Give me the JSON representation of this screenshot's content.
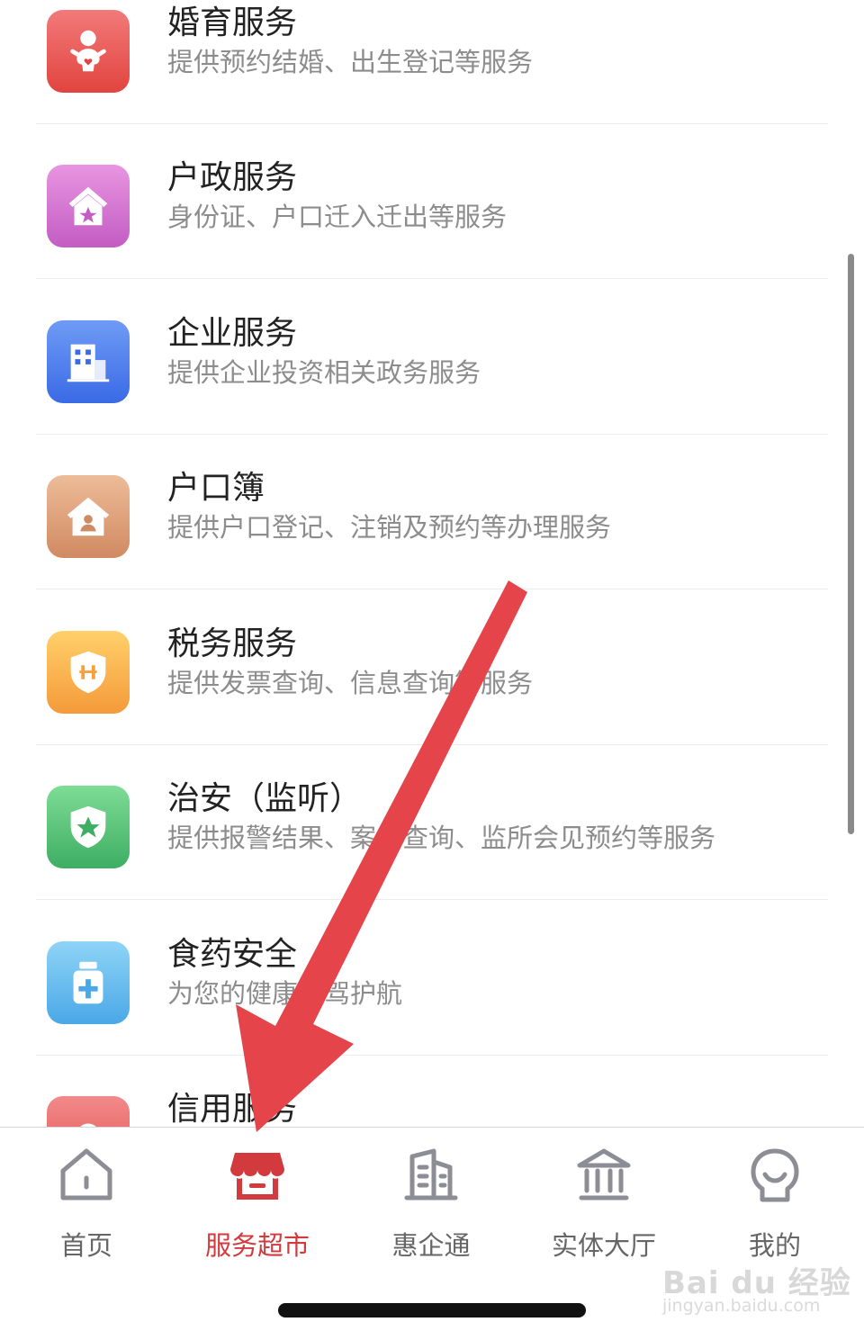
{
  "services": [
    {
      "title": "婚育服务",
      "desc": "提供预约结婚、出生登记等服务",
      "icon": "baby-icon",
      "colors": [
        "#f27a7a",
        "#e2443f"
      ]
    },
    {
      "title": "户政服务",
      "desc": "身份证、户口迁入迁出等服务",
      "icon": "house-star-icon",
      "colors": [
        "#e895e0",
        "#c35cc4"
      ]
    },
    {
      "title": "企业服务",
      "desc": "提供企业投资相关政务服务",
      "icon": "building-icon",
      "colors": [
        "#6f9bf5",
        "#3a6ae6"
      ]
    },
    {
      "title": "户口簿",
      "desc": "提供户口登记、注销及预约等办理服务",
      "icon": "house-person-icon",
      "colors": [
        "#edbc98",
        "#d08a62"
      ]
    },
    {
      "title": "税务服务",
      "desc": "提供发票查询、信息查询等服务",
      "icon": "tax-shield-icon",
      "colors": [
        "#ffd06a",
        "#f59a3a"
      ]
    },
    {
      "title": "治安（监听）",
      "desc": "提供报警结果、案件查询、监所会见预约等服务",
      "icon": "shield-star-icon",
      "colors": [
        "#7edc95",
        "#3dae63"
      ]
    },
    {
      "title": "食药安全",
      "desc": "为您的健康保驾护航",
      "icon": "medicine-bottle-icon",
      "colors": [
        "#8ed4f7",
        "#4aa8e6"
      ]
    },
    {
      "title": "信用服务",
      "desc": "",
      "icon": "credit-icon",
      "colors": [
        "#f28a8a",
        "#e0504e"
      ]
    }
  ],
  "tabbar": {
    "tabs": [
      {
        "label": "首页",
        "icon": "home-icon",
        "active": false
      },
      {
        "label": "服务超市",
        "icon": "store-icon",
        "active": true
      },
      {
        "label": "惠企通",
        "icon": "office-building-icon",
        "active": false
      },
      {
        "label": "实体大厅",
        "icon": "hall-icon",
        "active": false
      },
      {
        "label": "我的",
        "icon": "profile-icon",
        "active": false
      }
    ]
  },
  "watermark": {
    "brand": "Bai du 经验",
    "url": "jingyan.baidu.com"
  },
  "colors": {
    "accent": "#d23a3e",
    "annotation_arrow": "#e4444a"
  }
}
